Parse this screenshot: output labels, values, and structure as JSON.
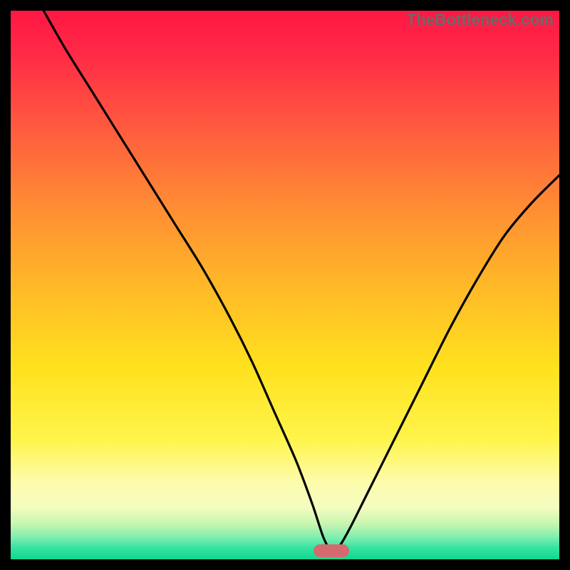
{
  "watermark": "TheBottleneck.com",
  "marker": {
    "color": "#d46a6f",
    "x_frac": 0.585,
    "y_frac": 0.985
  },
  "gradient_stops": [
    {
      "offset": 0.0,
      "color": "#ff1744"
    },
    {
      "offset": 0.08,
      "color": "#ff2a46"
    },
    {
      "offset": 0.2,
      "color": "#ff5640"
    },
    {
      "offset": 0.35,
      "color": "#ff8a34"
    },
    {
      "offset": 0.5,
      "color": "#ffb828"
    },
    {
      "offset": 0.65,
      "color": "#ffe11e"
    },
    {
      "offset": 0.78,
      "color": "#fff44a"
    },
    {
      "offset": 0.86,
      "color": "#fdfcac"
    },
    {
      "offset": 0.905,
      "color": "#f4fcc0"
    },
    {
      "offset": 0.935,
      "color": "#c8f6b0"
    },
    {
      "offset": 0.96,
      "color": "#7eeeb0"
    },
    {
      "offset": 0.98,
      "color": "#32e3a0"
    },
    {
      "offset": 1.0,
      "color": "#10d890"
    }
  ],
  "chart_data": {
    "type": "line",
    "title": "",
    "xlabel": "",
    "ylabel": "",
    "xlim": [
      0,
      100
    ],
    "ylim": [
      0,
      100
    ],
    "grid": false,
    "series": [
      {
        "name": "bottleneck-curve",
        "x": [
          6,
          10,
          15,
          20,
          25,
          30,
          35,
          40,
          44,
          48,
          52,
          55,
          57,
          58.5,
          60,
          62,
          65,
          70,
          75,
          80,
          85,
          90,
          95,
          100
        ],
        "values": [
          100,
          93,
          85,
          77,
          69,
          61,
          53,
          44,
          36,
          27,
          18,
          10,
          4,
          1.5,
          2.5,
          6,
          12,
          22,
          32,
          42,
          51,
          59,
          65,
          70
        ]
      }
    ],
    "marker_point": {
      "x": 58.5,
      "y": 1.5
    }
  }
}
